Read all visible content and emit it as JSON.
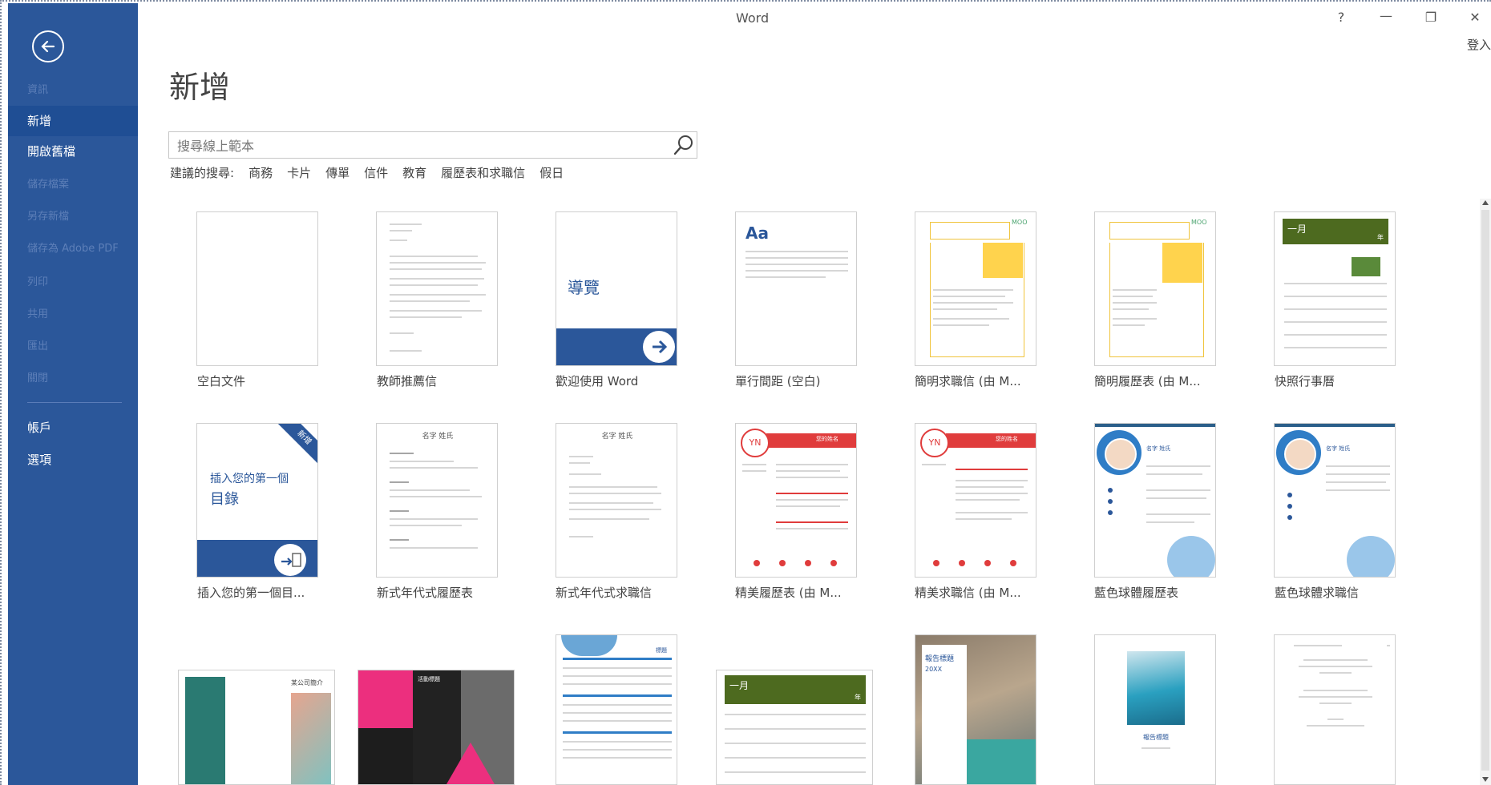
{
  "window": {
    "title": "Word",
    "help": "?",
    "minimize": "—",
    "restore": "❐",
    "close": "✕",
    "signin": "登入"
  },
  "sidebar": {
    "back_label": "←",
    "items": [
      {
        "label": "資訊",
        "state": "faded"
      },
      {
        "label": "新增",
        "state": "active"
      },
      {
        "label": "開啟舊檔",
        "state": "normal"
      },
      {
        "label": "儲存檔案",
        "state": "faded"
      },
      {
        "label": "另存新檔",
        "state": "faded"
      },
      {
        "label": "儲存為 Adobe PDF",
        "state": "faded"
      },
      {
        "label": "列印",
        "state": "faded"
      },
      {
        "label": "共用",
        "state": "faded"
      },
      {
        "label": "匯出",
        "state": "faded"
      },
      {
        "label": "關閉",
        "state": "faded"
      },
      {
        "label": "帳戶",
        "state": "normal"
      },
      {
        "label": "選項",
        "state": "normal"
      }
    ]
  },
  "main": {
    "title": "新增",
    "search": {
      "placeholder": "搜尋線上範本"
    },
    "suggested": {
      "lead": "建議的搜尋:",
      "links": [
        "商務",
        "卡片",
        "傳單",
        "信件",
        "教育",
        "履歷表和求職信",
        "假日"
      ]
    },
    "templates": [
      {
        "label": "空白文件"
      },
      {
        "label": "教師推薦信"
      },
      {
        "label": "歡迎使用 Word",
        "thumb_text": "導覽"
      },
      {
        "label": "單行間距 (空白)",
        "thumb_text": "Aa"
      },
      {
        "label": "簡明求職信 (由 M...",
        "badge": "MOO"
      },
      {
        "label": "簡明履歷表 (由 M...",
        "badge": "MOO"
      },
      {
        "label": "快照行事曆",
        "thumb_text": "一月",
        "thumb_text2": "年"
      },
      {
        "label": "插入您的第一個目...",
        "thumb_text": "插入您的第一個",
        "thumb_text2": "目錄",
        "ribbon": "新增"
      },
      {
        "label": "新式年代式履歷表",
        "thumb_text": "名字 姓氏"
      },
      {
        "label": "新式年代式求職信",
        "thumb_text": "名字 姓氏"
      },
      {
        "label": "精美履歷表 (由 M...",
        "thumb_text": "YN",
        "thumb_text2": "您的姓名"
      },
      {
        "label": "精美求職信 (由 M...",
        "thumb_text": "YN",
        "thumb_text2": "您的姓名"
      },
      {
        "label": "藍色球體履歷表",
        "thumb_text": "名字 姓氏"
      },
      {
        "label": "藍色球體求職信",
        "thumb_text": "名字 姓氏"
      },
      {
        "label": "",
        "thumb_text": "某公司簡介"
      },
      {
        "label": "",
        "thumb_text": "活動標題"
      },
      {
        "label": "",
        "thumb_text": "標題"
      },
      {
        "label": "",
        "thumb_text": "一月",
        "thumb_text2": "年"
      },
      {
        "label": "",
        "thumb_text": "報告標題",
        "thumb_text2": "20XX"
      },
      {
        "label": "",
        "thumb_text": "報告標題"
      },
      {
        "label": "",
        "thumb_text": ""
      }
    ]
  },
  "colors": {
    "sidebar_bg": "#2b579a",
    "sidebar_active": "#1f4e94",
    "word_blue": "#2b579a",
    "calendar_green": "#4d6a1f",
    "red_accent": "#e03c3c",
    "teal": "#2a8a8a"
  }
}
